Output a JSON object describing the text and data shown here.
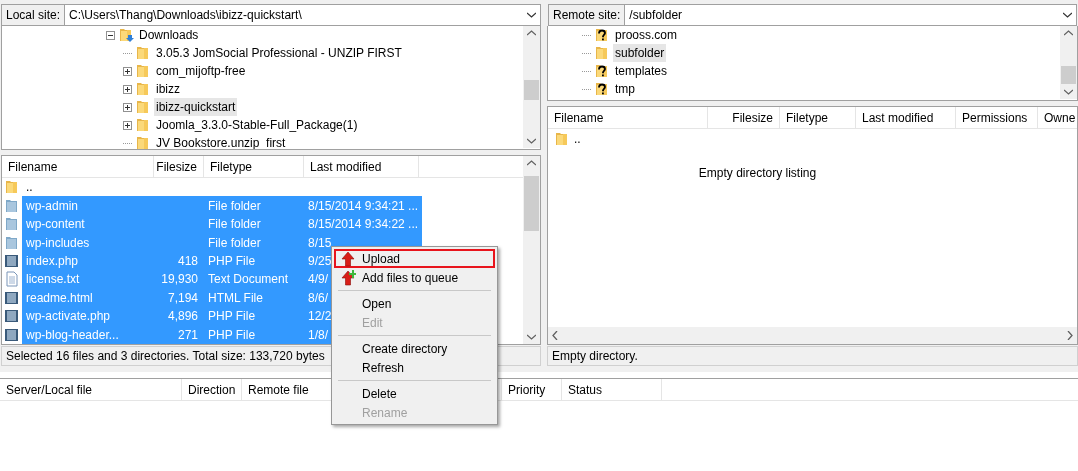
{
  "local": {
    "site_label": "Local site:",
    "path": "C:\\Users\\Thang\\Downloads\\ibizz-quickstart\\",
    "tree": [
      {
        "label": "Downloads",
        "kind": "download-folder",
        "expanded": true,
        "selected": false,
        "children": [
          {
            "label": "3.05.3 JomSocial Professional - UNZIP FIRST",
            "kind": "folder",
            "has_children": false,
            "selected": false
          },
          {
            "label": "com_mijoftp-free",
            "kind": "folder",
            "has_children": true,
            "selected": false
          },
          {
            "label": "ibizz",
            "kind": "folder",
            "has_children": true,
            "selected": false
          },
          {
            "label": "ibizz-quickstart",
            "kind": "folder",
            "has_children": true,
            "selected": true
          },
          {
            "label": "Joomla_3.3.0-Stable-Full_Package(1)",
            "kind": "folder",
            "has_children": true,
            "selected": false
          },
          {
            "label": "JV Bookstore.unzip_first",
            "kind": "folder",
            "has_children": false,
            "selected": false
          }
        ]
      }
    ],
    "columns": [
      "Filename",
      "Filesize",
      "Filetype",
      "Last modified"
    ],
    "files": [
      {
        "name": "..",
        "kind": "folder",
        "selected": false
      },
      {
        "name": "wp-admin",
        "type": "File folder",
        "modified": "8/15/2014 9:34:21 ...",
        "kind": "folder",
        "selected": true
      },
      {
        "name": "wp-content",
        "type": "File folder",
        "modified": "8/15/2014 9:34:22 ...",
        "kind": "folder",
        "selected": true
      },
      {
        "name": "wp-includes",
        "type": "File folder",
        "modified": "8/15",
        "kind": "folder",
        "selected": true
      },
      {
        "name": "index.php",
        "size": "418",
        "type": "PHP File",
        "modified": "9/25",
        "kind": "script",
        "selected": true
      },
      {
        "name": "license.txt",
        "size": "19,930",
        "type": "Text Document",
        "modified": "4/9/",
        "kind": "text",
        "selected": true
      },
      {
        "name": "readme.html",
        "size": "7,194",
        "type": "HTML File",
        "modified": "8/6/",
        "kind": "script",
        "selected": true
      },
      {
        "name": "wp-activate.php",
        "size": "4,896",
        "type": "PHP File",
        "modified": "12/2",
        "kind": "script",
        "selected": true
      },
      {
        "name": "wp-blog-header...",
        "size": "271",
        "type": "PHP File",
        "modified": "1/8/",
        "kind": "script",
        "selected": true
      }
    ],
    "status": "Selected 16 files and 3 directories. Total size: 133,720 bytes"
  },
  "remote": {
    "site_label": "Remote site:",
    "path": "/subfolder",
    "tree": [
      {
        "label": "prooss.com",
        "kind": "unknown",
        "selected": false
      },
      {
        "label": "subfolder",
        "kind": "folder",
        "selected": true
      },
      {
        "label": "templates",
        "kind": "unknown",
        "selected": false
      },
      {
        "label": "tmp",
        "kind": "unknown",
        "selected": false
      }
    ],
    "columns": [
      "Filename",
      "Filesize",
      "Filetype",
      "Last modified",
      "Permissions",
      "Owne"
    ],
    "files": [
      {
        "name": ".."
      }
    ],
    "empty_message": "Empty directory listing",
    "status": "Empty directory."
  },
  "queue": {
    "columns": [
      "Server/Local file",
      "Direction",
      "Remote file",
      "Priority",
      "Status"
    ]
  },
  "context_menu": [
    {
      "kind": "upload",
      "label": "Upload",
      "disabled": false,
      "outlined": true
    },
    {
      "kind": "queue",
      "label": "Add files to queue",
      "disabled": false,
      "outlined": false
    },
    {
      "kind": "separator"
    },
    {
      "kind": "item",
      "label": "Open",
      "disabled": false,
      "outlined": false
    },
    {
      "kind": "item",
      "label": "Edit",
      "disabled": true,
      "outlined": false
    },
    {
      "kind": "separator"
    },
    {
      "kind": "item",
      "label": "Create directory",
      "disabled": false,
      "outlined": false
    },
    {
      "kind": "item",
      "label": "Refresh",
      "disabled": false,
      "outlined": false
    },
    {
      "kind": "separator"
    },
    {
      "kind": "item",
      "label": "Delete",
      "disabled": false,
      "outlined": false
    },
    {
      "kind": "item",
      "label": "Rename",
      "disabled": true,
      "outlined": false
    }
  ]
}
